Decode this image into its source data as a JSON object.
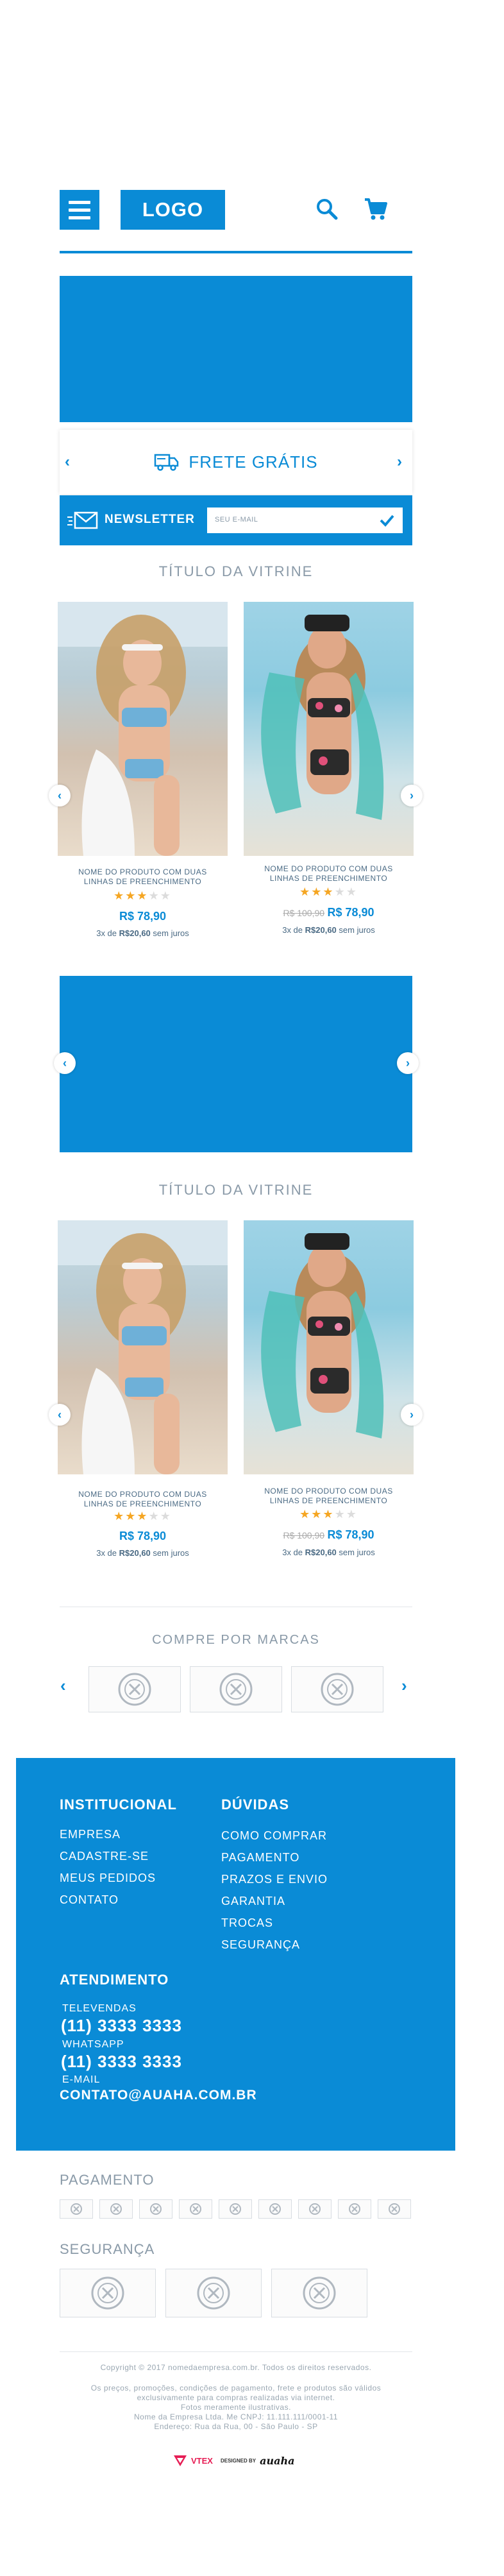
{
  "header": {
    "logo_text": "LOGO"
  },
  "frete": {
    "label": "FRETE GRÁTIS"
  },
  "newsletter": {
    "label": "NEWSLETTER",
    "placeholder": "SEU E-MAIL"
  },
  "vitrines": [
    {
      "title": "TÍTULO DA VITRINE",
      "products": [
        {
          "name_line1": "NOME DO PRODUTO COM DUAS",
          "name_line2": "LINHAS DE PREENCHIMENTO",
          "old_price": "",
          "price": "R$ 78,90",
          "inst_prefix": "3x de ",
          "inst_value": "R$20,60",
          "inst_suffix": " sem juros",
          "rating": 3
        },
        {
          "name_line1": "NOME DO PRODUTO COM DUAS",
          "name_line2": "LINHAS DE PREENCHIMENTO",
          "old_price": "R$ 100,90",
          "price": "R$ 78,90",
          "inst_prefix": "3x de ",
          "inst_value": "R$20,60",
          "inst_suffix": " sem juros",
          "rating": 3
        }
      ]
    },
    {
      "title": "TÍTULO DA VITRINE",
      "products": [
        {
          "name_line1": "NOME DO PRODUTO COM DUAS",
          "name_line2": "LINHAS DE PREENCHIMENTO",
          "old_price": "",
          "price": "R$ 78,90",
          "inst_prefix": "3x de ",
          "inst_value": "R$20,60",
          "inst_suffix": " sem juros",
          "rating": 3
        },
        {
          "name_line1": "NOME DO PRODUTO COM DUAS",
          "name_line2": "LINHAS DE PREENCHIMENTO",
          "old_price": "R$ 100,90",
          "price": "R$ 78,90",
          "inst_prefix": "3x de ",
          "inst_value": "R$20,60",
          "inst_suffix": " sem juros",
          "rating": 3
        }
      ]
    }
  ],
  "brands": {
    "title": "COMPRE POR MARCAS"
  },
  "footer": {
    "institucional": {
      "title": "INSTITUCIONAL",
      "links": [
        "EMPRESA",
        "CADASTRE-SE",
        "MEUS PEDIDOS",
        "CONTATO"
      ]
    },
    "duvidas": {
      "title": "DÚVIDAS",
      "links": [
        "COMO COMPRAR",
        "PAGAMENTO",
        "PRAZOS E ENVIO",
        "GARANTIA",
        "TROCAS",
        "SEGURANÇA"
      ]
    },
    "atendimento": {
      "title": "ATENDIMENTO",
      "televendas_label": "TELEVENDAS",
      "televendas": "(11) 3333 3333",
      "whatsapp_label": "WHATSAPP",
      "whatsapp": "(11) 3333 3333",
      "email_label": "E-MAIL",
      "email": "CONTATO@AUAHA.COM.BR"
    }
  },
  "payment": {
    "title": "PAGAMENTO"
  },
  "security": {
    "title": "SEGURANÇA"
  },
  "copyright": {
    "line1": "Copyright © 2017 nomedaempresa.com.br. Todos os direitos reservados.",
    "line2": "Os preços, promoções, condições de pagamento, frete e produtos são válidos",
    "line3": "exclusivamente para compras realizadas via internet.",
    "line4": "Fotos meramente ilustrativas.",
    "line5": "Nome da Empresa Ltda. Me CNPJ: 11.111.111/0001-11",
    "line6": "Endereço: Rua da Rua, 00 - São Paulo - SP"
  },
  "credits": {
    "vtex": "VTEX",
    "designed_by": "DESIGNED BY",
    "auaha": "auaha"
  },
  "colors": {
    "brand_blue": "#0a8bd6",
    "star": "#f5a623"
  },
  "icons": [
    "menu-icon",
    "search-icon",
    "cart-icon",
    "truck-icon",
    "envelope-icon",
    "check-icon",
    "chevron-left-icon",
    "chevron-right-icon",
    "brand-placeholder-icon"
  ]
}
